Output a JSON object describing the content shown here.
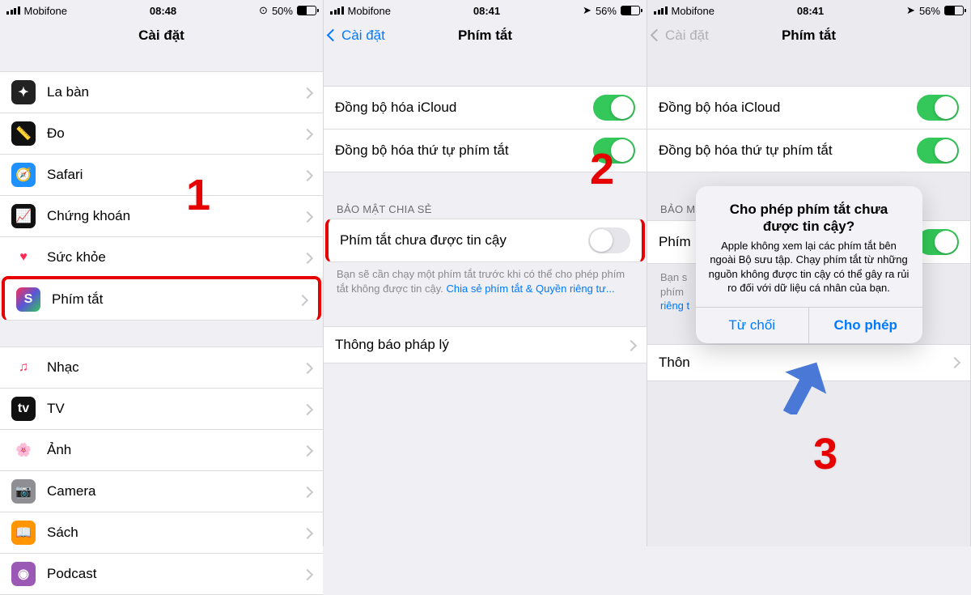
{
  "screens": [
    {
      "status": {
        "carrier": "Mobifone",
        "time": "08:48",
        "battery": "50%"
      },
      "title": "Cài đặt",
      "items": [
        {
          "label": "La bàn",
          "icon": "compass",
          "bg": "#222"
        },
        {
          "label": "Đo",
          "icon": "ruler",
          "bg": "#111"
        },
        {
          "label": "Safari",
          "icon": "safari",
          "bg": "#1e90ff"
        },
        {
          "label": "Chứng khoán",
          "icon": "stocks",
          "bg": "#111"
        },
        {
          "label": "Sức khỏe",
          "icon": "health",
          "bg": "#fff",
          "fg": "#ff2d55"
        },
        {
          "label": "Phím tắt",
          "icon": "shortcuts",
          "bg": "#1a1a3f"
        },
        {
          "label": "Nhạc",
          "icon": "music",
          "bg": "#fff",
          "fg": "#ff2d55"
        },
        {
          "label": "TV",
          "icon": "tv",
          "bg": "#111"
        },
        {
          "label": "Ảnh",
          "icon": "photos",
          "bg": "#fff"
        },
        {
          "label": "Camera",
          "icon": "camera",
          "bg": "#8e8e93"
        },
        {
          "label": "Sách",
          "icon": "books",
          "bg": "#ff9500"
        },
        {
          "label": "Podcast",
          "icon": "podcast",
          "bg": "#9b59b6"
        }
      ],
      "step": "1"
    },
    {
      "status": {
        "carrier": "Mobifone",
        "time": "08:41",
        "battery": "56%"
      },
      "back": "Cài đặt",
      "title": "Phím tắt",
      "sync_icloud": "Đồng bộ hóa iCloud",
      "sync_order": "Đồng bộ hóa thứ tự phím tắt",
      "section": "BẢO MẬT CHIA SẺ",
      "untrusted": "Phím tắt chưa được tin cậy",
      "footer_pre": "Bạn sẽ cần chạy một phím tắt trước khi có thể cho phép phím tắt không được tin cậy. ",
      "footer_link": "Chia sẻ phím tắt & Quyền riêng tư...",
      "legal": "Thông báo pháp lý",
      "step": "2"
    },
    {
      "status": {
        "carrier": "Mobifone",
        "time": "08:41",
        "battery": "56%"
      },
      "back": "Cài đặt",
      "title": "Phím tắt",
      "sync_icloud": "Đồng bộ hóa iCloud",
      "sync_order": "Đồng bộ hóa thứ tự phím tắt",
      "section_trunc": "BẢO M",
      "untrusted_trunc": "Phím",
      "footer_trunc1": "Bạn s",
      "footer_trunc2": "phím",
      "footer_trunc3": "riêng t",
      "legal_trunc": "Thôn",
      "alert_title": "Cho phép phím tắt chưa được tin cậy?",
      "alert_body": "Apple không xem lại các phím tắt bên ngoài Bộ sưu tập. Chạy phím tắt từ những nguồn không được tin cậy có thể gây ra rủi ro đối với dữ liệu cá nhân của bạn.",
      "alert_cancel": "Từ chối",
      "alert_ok": "Cho phép",
      "step": "3"
    }
  ]
}
